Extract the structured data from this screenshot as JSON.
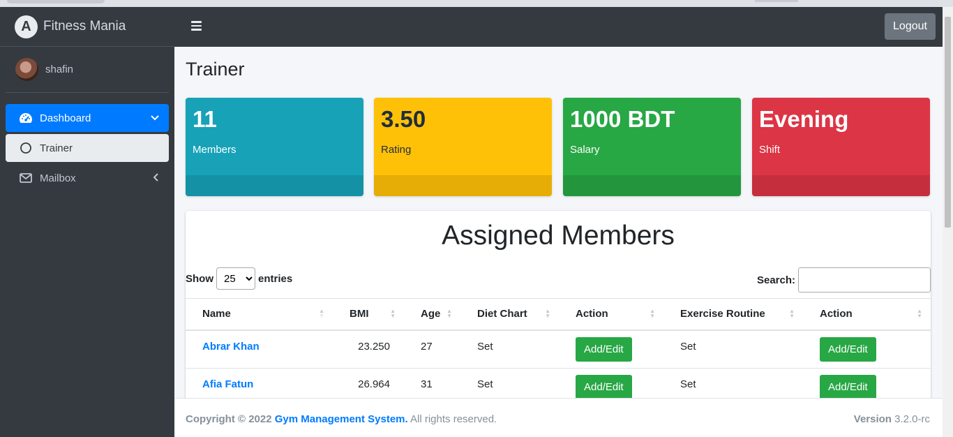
{
  "app": {
    "brand": "Fitness Mania",
    "user": "shafin"
  },
  "sidebar": {
    "items": [
      {
        "label": "Dashboard",
        "icon": "tachometer-icon",
        "state": "active"
      },
      {
        "label": "Trainer",
        "icon": "circle-icon",
        "state": "sub-selected"
      },
      {
        "label": "Mailbox",
        "icon": "envelope-icon",
        "state": "collapsed"
      }
    ]
  },
  "header": {
    "logout_label": "Logout"
  },
  "page": {
    "title": "Trainer"
  },
  "stats": [
    {
      "value": "11",
      "caption": "Members",
      "color": "#17a2b8",
      "text_color": "#ffffff"
    },
    {
      "value": "3.50",
      "caption": "Rating",
      "color": "#ffc107",
      "text_color": "#1f2d3d"
    },
    {
      "value": "1000 BDT",
      "caption": "Salary",
      "color": "#28a745",
      "text_color": "#ffffff"
    },
    {
      "value": "Evening",
      "caption": "Shift",
      "color": "#dc3545",
      "text_color": "#ffffff"
    }
  ],
  "members_card": {
    "title": "Assigned Members",
    "show_label": "Show",
    "entries_value": "25",
    "entries_label": "entries",
    "search_label": "Search:",
    "columns": [
      "Name",
      "BMI",
      "Age",
      "Diet Chart",
      "Action",
      "Exercise Routine",
      "Action"
    ],
    "rows": [
      {
        "name": "Abrar Khan",
        "bmi": "23.250",
        "age": "27",
        "diet": "Set",
        "diet_action": "Add/Edit",
        "exercise": "Set",
        "exercise_action": "Add/Edit"
      },
      {
        "name": "Afia Fatun",
        "bmi": "26.964",
        "age": "31",
        "diet": "Set",
        "diet_action": "Add/Edit",
        "exercise": "Set",
        "exercise_action": "Add/Edit"
      }
    ]
  },
  "footer": {
    "copyright_prefix": "Copyright © 2022",
    "company": "Gym Management System.",
    "rights": "All rights reserved.",
    "version_label": "Version",
    "version_value": "3.2.0-rc"
  }
}
